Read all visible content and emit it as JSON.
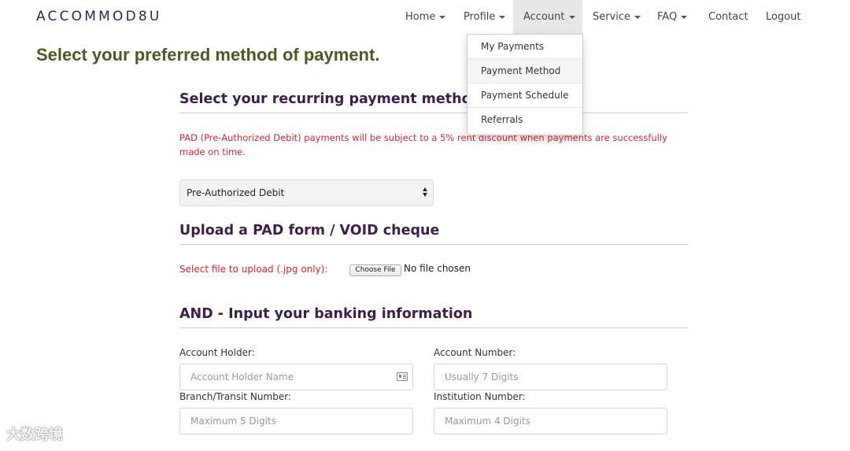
{
  "brand": "ACCOMMOD8U",
  "nav": {
    "home": "Home",
    "profile": "Profile",
    "account": "Account",
    "service": "Service",
    "faq": "FAQ",
    "contact": "Contact",
    "logout": "Logout"
  },
  "account_menu": {
    "items": [
      "My Payments",
      "Payment Method",
      "Payment Schedule",
      "Referrals"
    ],
    "hovered": "Payment Method"
  },
  "page_title": "Select your preferred method of payment.",
  "recurring": {
    "title": "Select your recurring payment method",
    "notice": "PAD (Pre-Authorized Debit) payments will be subject to a 5% rent discount when payments are successfully made on time.",
    "selected": "Pre-Authorized Debit"
  },
  "upload": {
    "title": "Upload a PAD form / VOID cheque",
    "label": "Select file to upload (.jpg only):",
    "button": "Choose File",
    "status": "No file chosen"
  },
  "banking": {
    "title": "AND - Input your banking information",
    "account_holder_label": "Account Holder:",
    "account_holder_placeholder": "Account Holder Name",
    "account_number_label": "Account Number:",
    "account_number_placeholder": "Usually 7 Digits",
    "branch_label": "Branch/Transit Number:",
    "branch_placeholder": "Maximum 5 Digits",
    "institution_label": "Institution Number:",
    "institution_placeholder": "Maximum 4 Digits"
  },
  "watermark": "大数跨境",
  "colors": {
    "brand": "#3d1f4f",
    "heading": "#4a5a23",
    "notice_red": "#e4232b"
  }
}
